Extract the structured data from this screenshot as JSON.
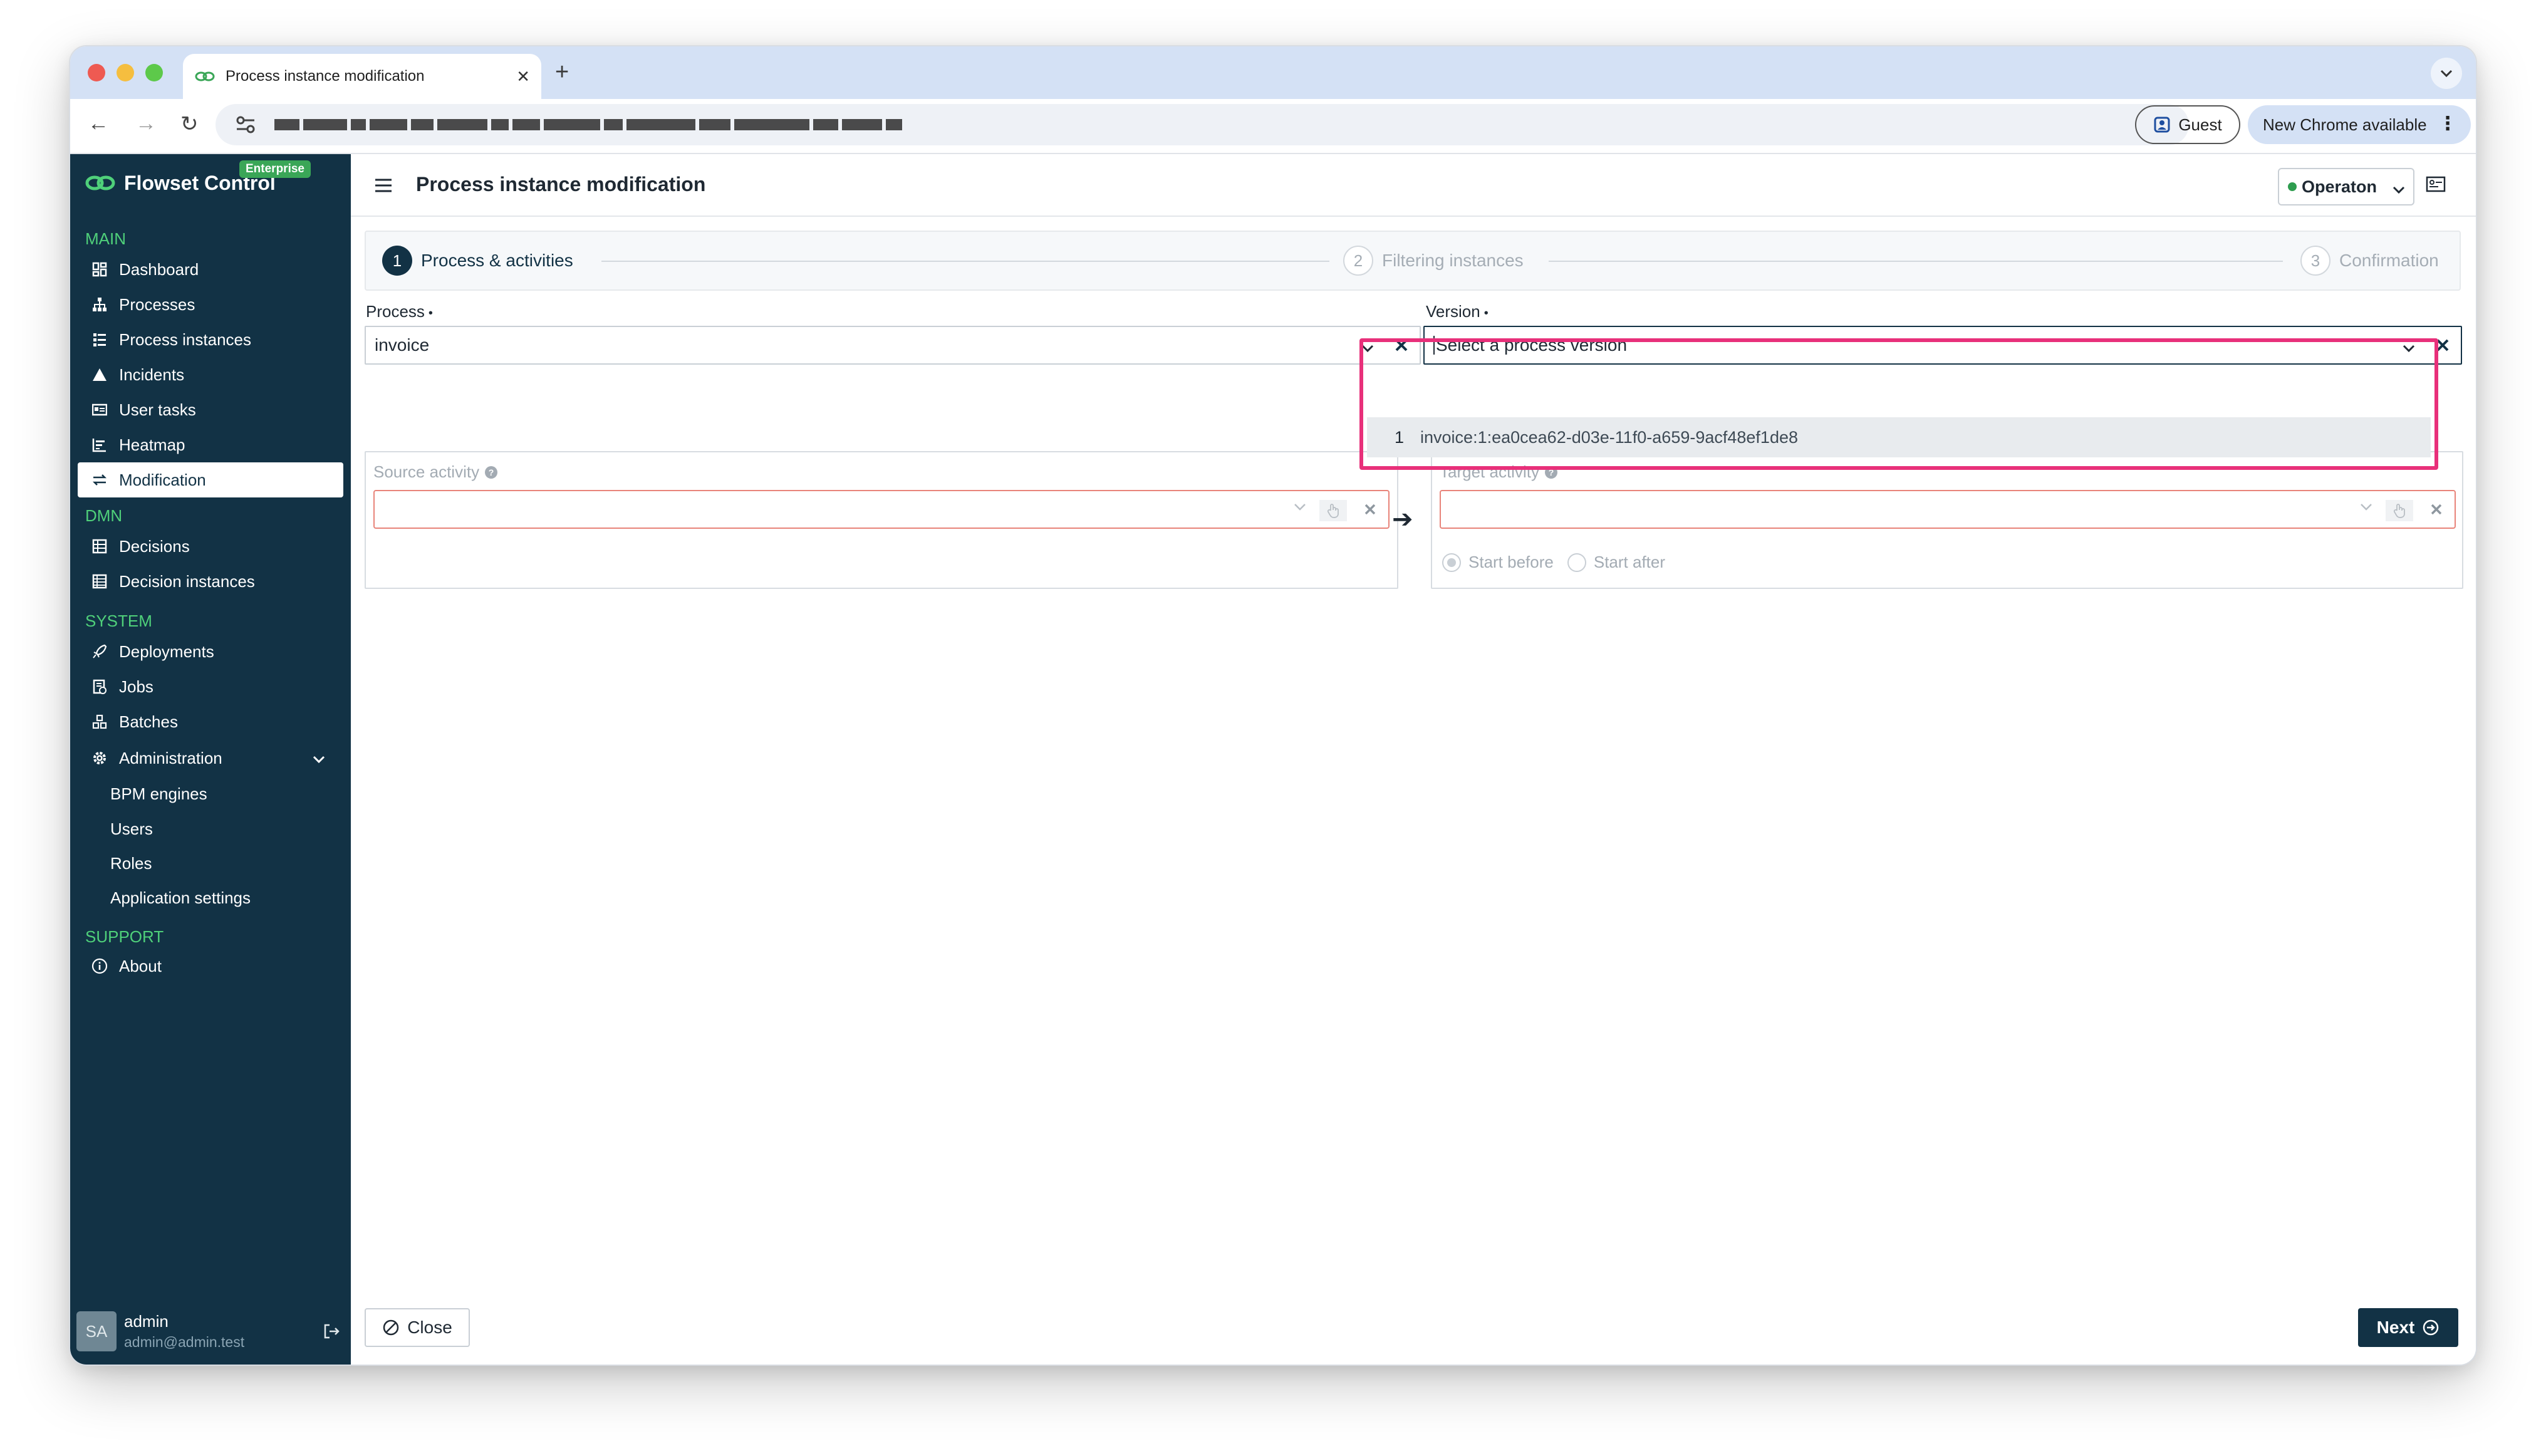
{
  "browser": {
    "tab_title": "Process instance modification",
    "guest_label": "Guest",
    "update_label": "New Chrome available"
  },
  "sidebar": {
    "brand": "Flowset Control",
    "badge": "Enterprise",
    "sections": {
      "main": "MAIN",
      "dmn": "DMN",
      "system": "SYSTEM",
      "support": "SUPPORT"
    },
    "items": {
      "dashboard": "Dashboard",
      "processes": "Processes",
      "process_instances": "Process instances",
      "incidents": "Incidents",
      "user_tasks": "User tasks",
      "heatmap": "Heatmap",
      "modification": "Modification",
      "decisions": "Decisions",
      "decision_instances": "Decision instances",
      "deployments": "Deployments",
      "jobs": "Jobs",
      "batches": "Batches",
      "administration": "Administration",
      "bpm_engines": "BPM engines",
      "users": "Users",
      "roles": "Roles",
      "application_settings": "Application settings",
      "about": "About"
    },
    "user": {
      "initials": "SA",
      "name": "admin",
      "email": "admin@admin.test"
    }
  },
  "header": {
    "title": "Process instance modification",
    "engine": "Operaton"
  },
  "stepper": [
    {
      "num": "1",
      "label": "Process & activities"
    },
    {
      "num": "2",
      "label": "Filtering instances"
    },
    {
      "num": "3",
      "label": "Confirmation"
    }
  ],
  "form": {
    "process_label": "Process",
    "process_value": "invoice",
    "version_label": "Version",
    "version_placeholder": "Select a process version",
    "version_option_num": "1",
    "version_option": "invoice:1:ea0cea62-d03e-11f0-a659-9acf48ef1de8",
    "source_label": "Source activity",
    "target_label": "Target activity",
    "start_before": "Start before",
    "start_after": "Start after"
  },
  "footer": {
    "close": "Close",
    "next": "Next"
  },
  "colors": {
    "sidebar_bg": "#123245",
    "accent_green": "#4fd07a",
    "highlight": "#e8307a"
  }
}
